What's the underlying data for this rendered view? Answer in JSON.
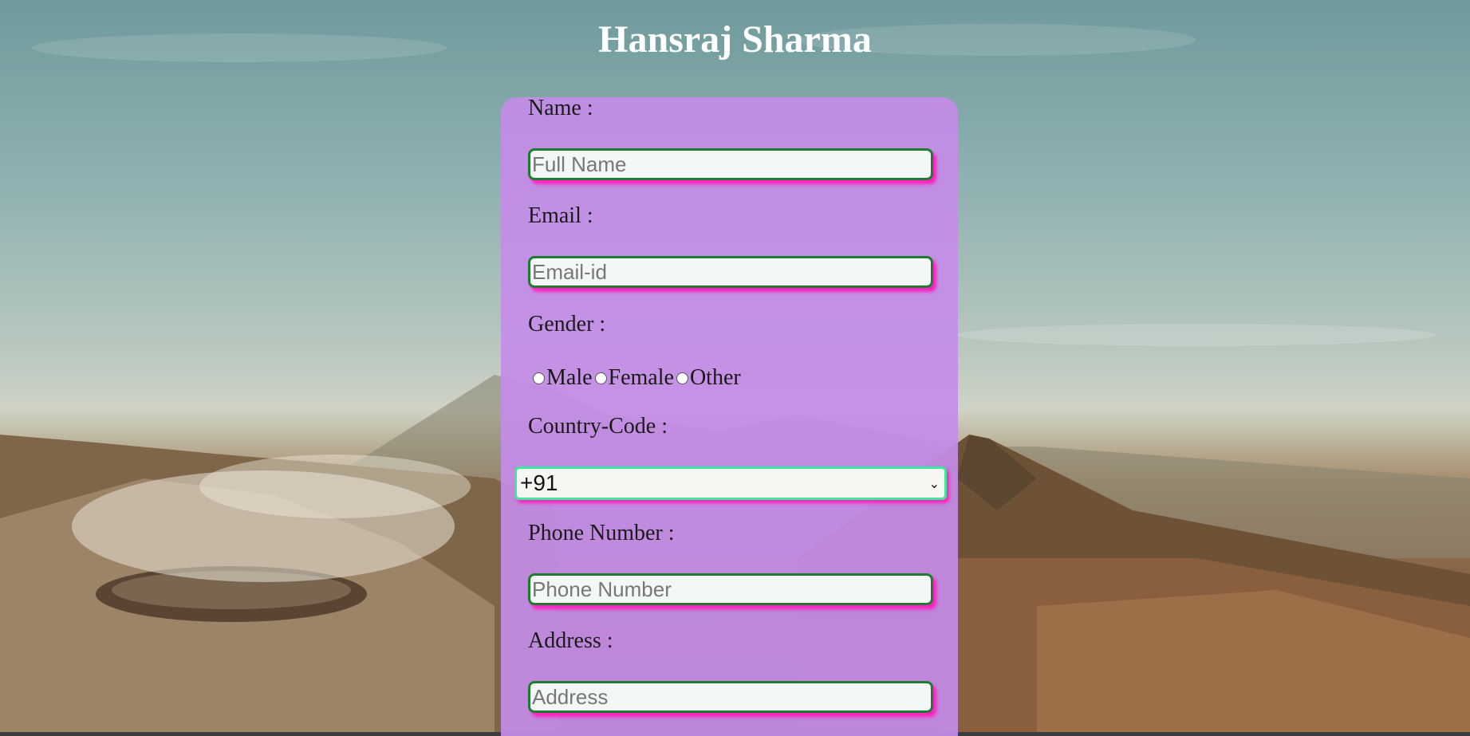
{
  "header": {
    "title": "Hansraj Sharma"
  },
  "form": {
    "name_label": "Name :",
    "name_placeholder": "Full Name",
    "email_label": "Email :",
    "email_placeholder": "Email-id",
    "gender_label": "Gender :",
    "gender_options": [
      "Male",
      "Female",
      "Other"
    ],
    "country_label": "Country-Code :",
    "country_value": "+91",
    "phone_label": "Phone Number :",
    "phone_placeholder": "Phone Number",
    "address_label": "Address :",
    "address_placeholder": "Address"
  },
  "colors": {
    "card": "#c48ce8",
    "input_border": "#1f7a32",
    "select_border": "#3ee89a",
    "shadow": "#ff1fbf"
  }
}
